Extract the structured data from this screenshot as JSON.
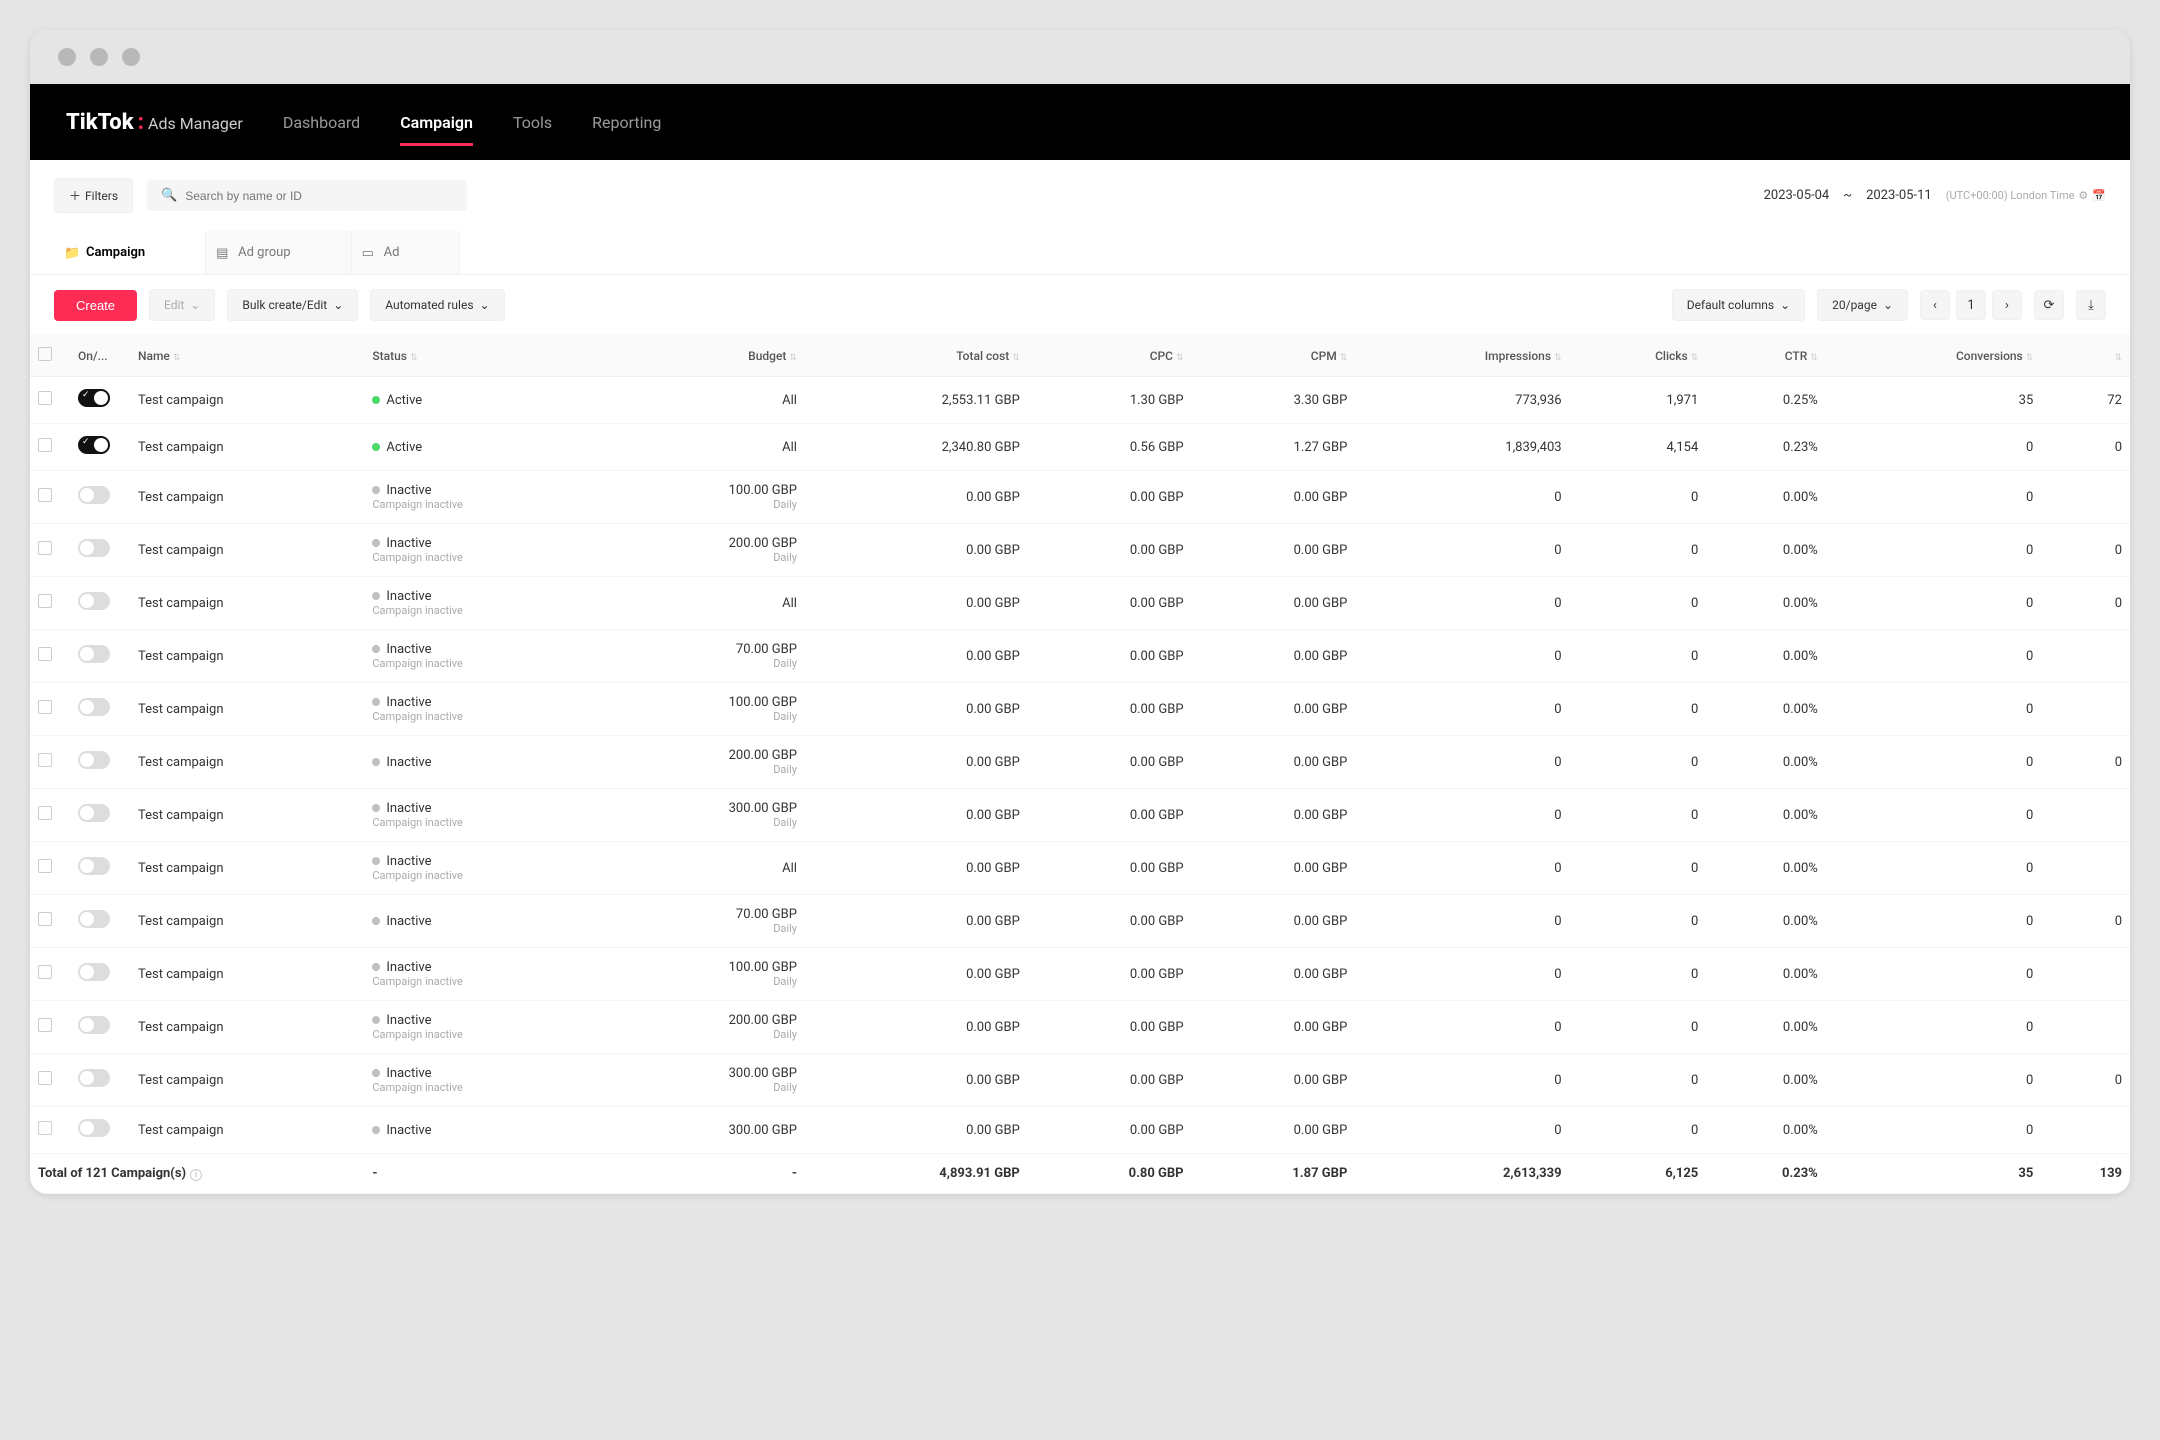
{
  "logo": {
    "main": "TikTok",
    "sub": "Ads Manager"
  },
  "nav": [
    "Dashboard",
    "Campaign",
    "Tools",
    "Reporting"
  ],
  "nav_active": 1,
  "toolbar": {
    "filters": "Filters",
    "search_placeholder": "Search by name or ID",
    "date_from": "2023-05-04",
    "date_to": "2023-05-11",
    "tz": "(UTC+00:00) London Time"
  },
  "tabs": [
    "Campaign",
    "Ad group",
    "Ad"
  ],
  "tabs_active": 0,
  "actions": {
    "create": "Create",
    "edit": "Edit",
    "bulk": "Bulk create/Edit",
    "auto": "Automated rules",
    "cols": "Default columns",
    "per_page": "20/page",
    "page": "1"
  },
  "cols": [
    "",
    "On/...",
    "Name",
    "Status",
    "Budget",
    "Total cost",
    "CPC",
    "CPM",
    "Impressions",
    "Clicks",
    "CTR",
    "Conversions",
    ""
  ],
  "rows": [
    {
      "on": true,
      "name": "Test campaign",
      "status": "Active",
      "sub": "",
      "budget": "All",
      "bsub": "",
      "cost": "2,553.11 GBP",
      "cpc": "1.30 GBP",
      "cpm": "3.30 GBP",
      "imp": "773,936",
      "clk": "1,971",
      "ctr": "0.25%",
      "conv": "35",
      "ext": "72"
    },
    {
      "on": true,
      "name": "Test campaign",
      "status": "Active",
      "sub": "",
      "budget": "All",
      "bsub": "",
      "cost": "2,340.80 GBP",
      "cpc": "0.56 GBP",
      "cpm": "1.27 GBP",
      "imp": "1,839,403",
      "clk": "4,154",
      "ctr": "0.23%",
      "conv": "0",
      "ext": "0"
    },
    {
      "on": false,
      "name": "Test campaign",
      "status": "Inactive",
      "sub": "Campaign inactive",
      "budget": "100.00 GBP",
      "bsub": "Daily",
      "cost": "0.00 GBP",
      "cpc": "0.00 GBP",
      "cpm": "0.00 GBP",
      "imp": "0",
      "clk": "0",
      "ctr": "0.00%",
      "conv": "0",
      "ext": ""
    },
    {
      "on": false,
      "name": "Test campaign",
      "status": "Inactive",
      "sub": "Campaign inactive",
      "budget": "200.00 GBP",
      "bsub": "Daily",
      "cost": "0.00 GBP",
      "cpc": "0.00 GBP",
      "cpm": "0.00 GBP",
      "imp": "0",
      "clk": "0",
      "ctr": "0.00%",
      "conv": "0",
      "ext": "0"
    },
    {
      "on": false,
      "name": "Test campaign",
      "status": "Inactive",
      "sub": "Campaign inactive",
      "budget": "All",
      "bsub": "",
      "cost": "0.00 GBP",
      "cpc": "0.00 GBP",
      "cpm": "0.00 GBP",
      "imp": "0",
      "clk": "0",
      "ctr": "0.00%",
      "conv": "0",
      "ext": "0"
    },
    {
      "on": false,
      "name": "Test campaign",
      "status": "Inactive",
      "sub": "Campaign inactive",
      "budget": "70.00 GBP",
      "bsub": "Daily",
      "cost": "0.00 GBP",
      "cpc": "0.00 GBP",
      "cpm": "0.00 GBP",
      "imp": "0",
      "clk": "0",
      "ctr": "0.00%",
      "conv": "0",
      "ext": ""
    },
    {
      "on": false,
      "name": "Test campaign",
      "status": "Inactive",
      "sub": "Campaign inactive",
      "budget": "100.00 GBP",
      "bsub": "Daily",
      "cost": "0.00 GBP",
      "cpc": "0.00 GBP",
      "cpm": "0.00 GBP",
      "imp": "0",
      "clk": "0",
      "ctr": "0.00%",
      "conv": "0",
      "ext": ""
    },
    {
      "on": false,
      "name": "Test campaign",
      "status": "Inactive",
      "sub": "",
      "budget": "200.00 GBP",
      "bsub": "Daily",
      "cost": "0.00 GBP",
      "cpc": "0.00 GBP",
      "cpm": "0.00 GBP",
      "imp": "0",
      "clk": "0",
      "ctr": "0.00%",
      "conv": "0",
      "ext": "0"
    },
    {
      "on": false,
      "name": "Test campaign",
      "status": "Inactive",
      "sub": "Campaign inactive",
      "budget": "300.00 GBP",
      "bsub": "Daily",
      "cost": "0.00 GBP",
      "cpc": "0.00 GBP",
      "cpm": "0.00 GBP",
      "imp": "0",
      "clk": "0",
      "ctr": "0.00%",
      "conv": "0",
      "ext": ""
    },
    {
      "on": false,
      "name": "Test campaign",
      "status": "Inactive",
      "sub": "Campaign inactive",
      "budget": "All",
      "bsub": "",
      "cost": "0.00 GBP",
      "cpc": "0.00 GBP",
      "cpm": "0.00 GBP",
      "imp": "0",
      "clk": "0",
      "ctr": "0.00%",
      "conv": "0",
      "ext": ""
    },
    {
      "on": false,
      "name": "Test campaign",
      "status": "Inactive",
      "sub": "",
      "budget": "70.00 GBP",
      "bsub": "Daily",
      "cost": "0.00 GBP",
      "cpc": "0.00 GBP",
      "cpm": "0.00 GBP",
      "imp": "0",
      "clk": "0",
      "ctr": "0.00%",
      "conv": "0",
      "ext": "0"
    },
    {
      "on": false,
      "name": "Test campaign",
      "status": "Inactive",
      "sub": "Campaign inactive",
      "budget": "100.00 GBP",
      "bsub": "Daily",
      "cost": "0.00 GBP",
      "cpc": "0.00 GBP",
      "cpm": "0.00 GBP",
      "imp": "0",
      "clk": "0",
      "ctr": "0.00%",
      "conv": "0",
      "ext": ""
    },
    {
      "on": false,
      "name": "Test campaign",
      "status": "Inactive",
      "sub": "Campaign inactive",
      "budget": "200.00 GBP",
      "bsub": "Daily",
      "cost": "0.00 GBP",
      "cpc": "0.00 GBP",
      "cpm": "0.00 GBP",
      "imp": "0",
      "clk": "0",
      "ctr": "0.00%",
      "conv": "0",
      "ext": ""
    },
    {
      "on": false,
      "name": "Test campaign",
      "status": "Inactive",
      "sub": "Campaign inactive",
      "budget": "300.00 GBP",
      "bsub": "Daily",
      "cost": "0.00 GBP",
      "cpc": "0.00 GBP",
      "cpm": "0.00 GBP",
      "imp": "0",
      "clk": "0",
      "ctr": "0.00%",
      "conv": "0",
      "ext": "0"
    },
    {
      "on": false,
      "name": "Test campaign",
      "status": "Inactive",
      "sub": "",
      "budget": "300.00 GBP",
      "bsub": "",
      "cost": "0.00 GBP",
      "cpc": "0.00 GBP",
      "cpm": "0.00 GBP",
      "imp": "0",
      "clk": "0",
      "ctr": "0.00%",
      "conv": "0",
      "ext": ""
    }
  ],
  "totals": {
    "label": "Total of 121 Campaign(s)",
    "status": "-",
    "budget": "-",
    "cost": "4,893.91 GBP",
    "cpc": "0.80 GBP",
    "cpm": "1.87 GBP",
    "imp": "2,613,339",
    "clk": "6,125",
    "ctr": "0.23%",
    "conv": "35",
    "ext": "139"
  }
}
